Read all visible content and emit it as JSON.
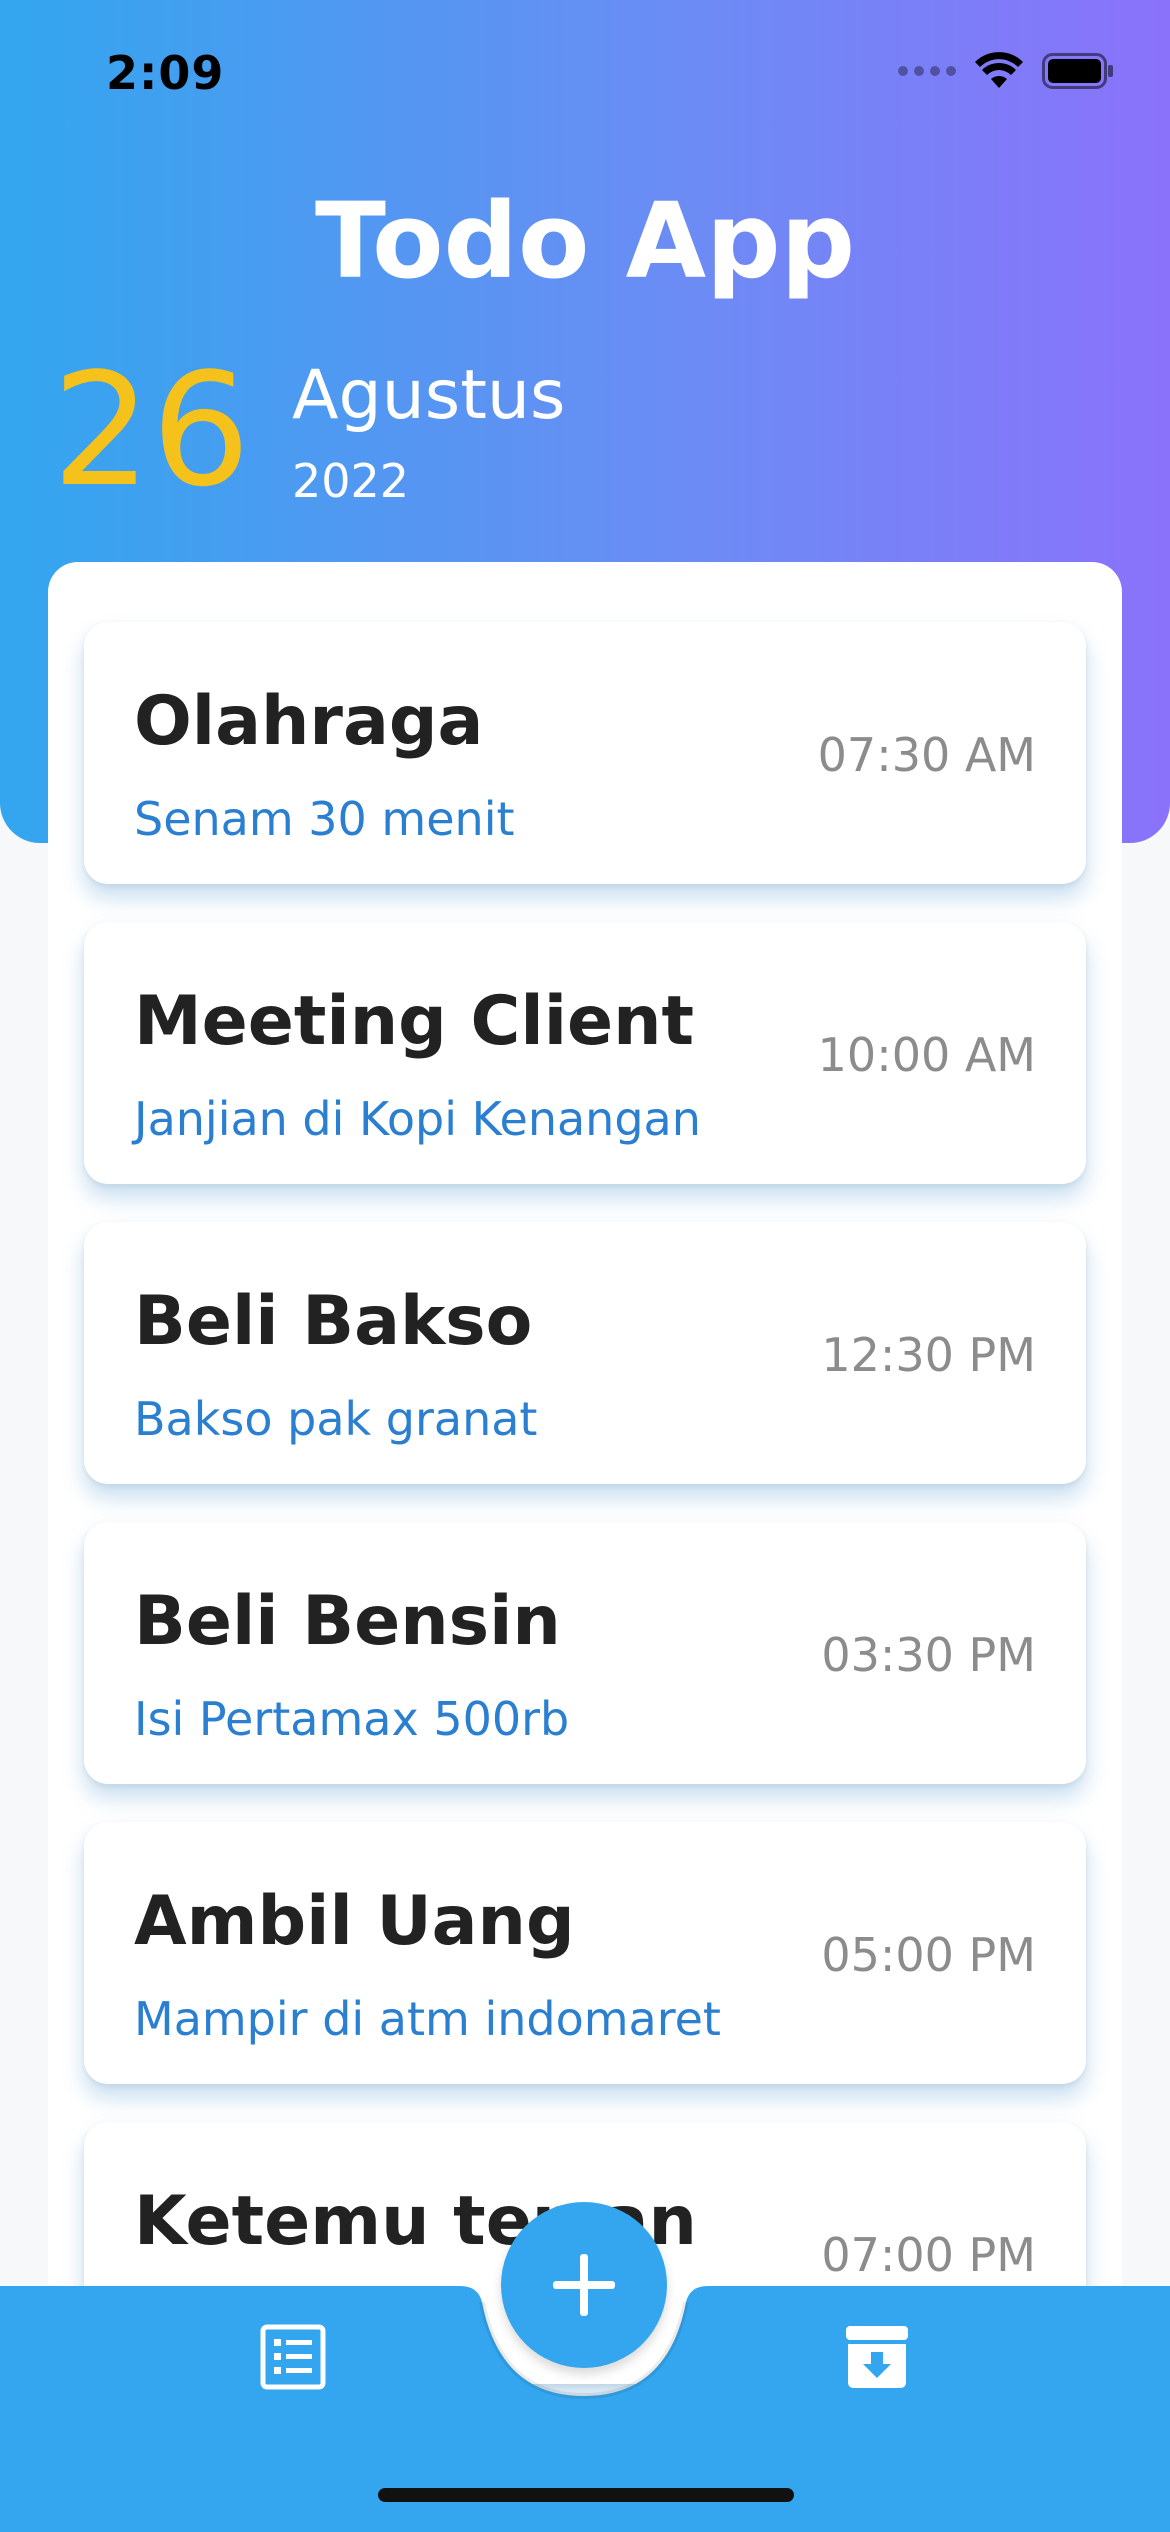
{
  "status_bar": {
    "time": "2:09"
  },
  "header": {
    "title": "Todo App",
    "day": "26",
    "month": "Agustus",
    "year": "2022"
  },
  "todos": [
    {
      "title": "Olahraga",
      "description": "Senam 30 menit",
      "time": "07:30 AM"
    },
    {
      "title": "Meeting Client",
      "description": "Janjian di Kopi Kenangan",
      "time": "10:00 AM"
    },
    {
      "title": "Beli Bakso",
      "description": "Bakso pak granat",
      "time": "12:30 PM"
    },
    {
      "title": "Beli Bensin",
      "description": "Isi Pertamax 500rb",
      "time": "03:30 PM"
    },
    {
      "title": "Ambil Uang",
      "description": "Mampir di atm indomaret",
      "time": "05:00 PM"
    },
    {
      "title": "Ketemu teman",
      "description": "",
      "time": "07:00 PM"
    }
  ],
  "bottom_nav": {
    "left_icon": "list-icon",
    "center_icon": "plus-icon",
    "right_icon": "archive-download-icon"
  },
  "colors": {
    "gradient_start": "#33a6ef",
    "gradient_end": "#8a72fb",
    "accent_day": "#f5c21b",
    "description": "#2a7fd1",
    "nav_bar": "#33a6ef"
  }
}
